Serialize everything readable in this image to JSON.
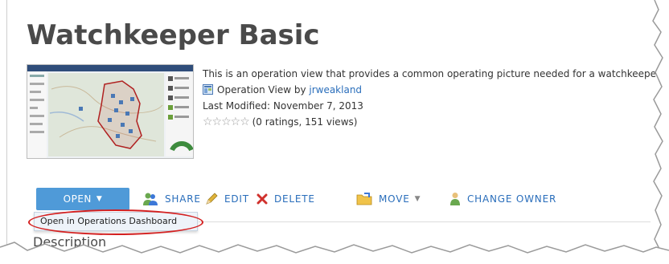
{
  "item": {
    "title": "Watchkeeper Basic",
    "summary": "This is an operation view that provides a common operating picture needed for a watchkeeper.",
    "type_prefix": "Operation View by ",
    "owner": "jrweakland",
    "last_modified": "Last Modified: November 7, 2013",
    "ratings": "(0 ratings, 151 views)",
    "rating_stars": 0
  },
  "actions": {
    "open": "OPEN",
    "share": "SHARE",
    "edit": "EDIT",
    "delete": "DELETE",
    "move": "MOVE",
    "change_owner": "CHANGE OWNER"
  },
  "dropdown": {
    "open_in_dashboard": "Open in Operations Dashboard"
  },
  "section": {
    "description": "Description"
  },
  "icons": {
    "operation_view": "operation-view-icon",
    "share": "share-people-icon",
    "edit": "pencil-icon",
    "delete": "x-icon",
    "move": "folder-icon",
    "change_owner": "person-icon"
  },
  "colors": {
    "accent": "#4f9ad8",
    "link": "#2a6ebb",
    "highlight_circle": "#d42020",
    "delete_red": "#d0312d"
  }
}
